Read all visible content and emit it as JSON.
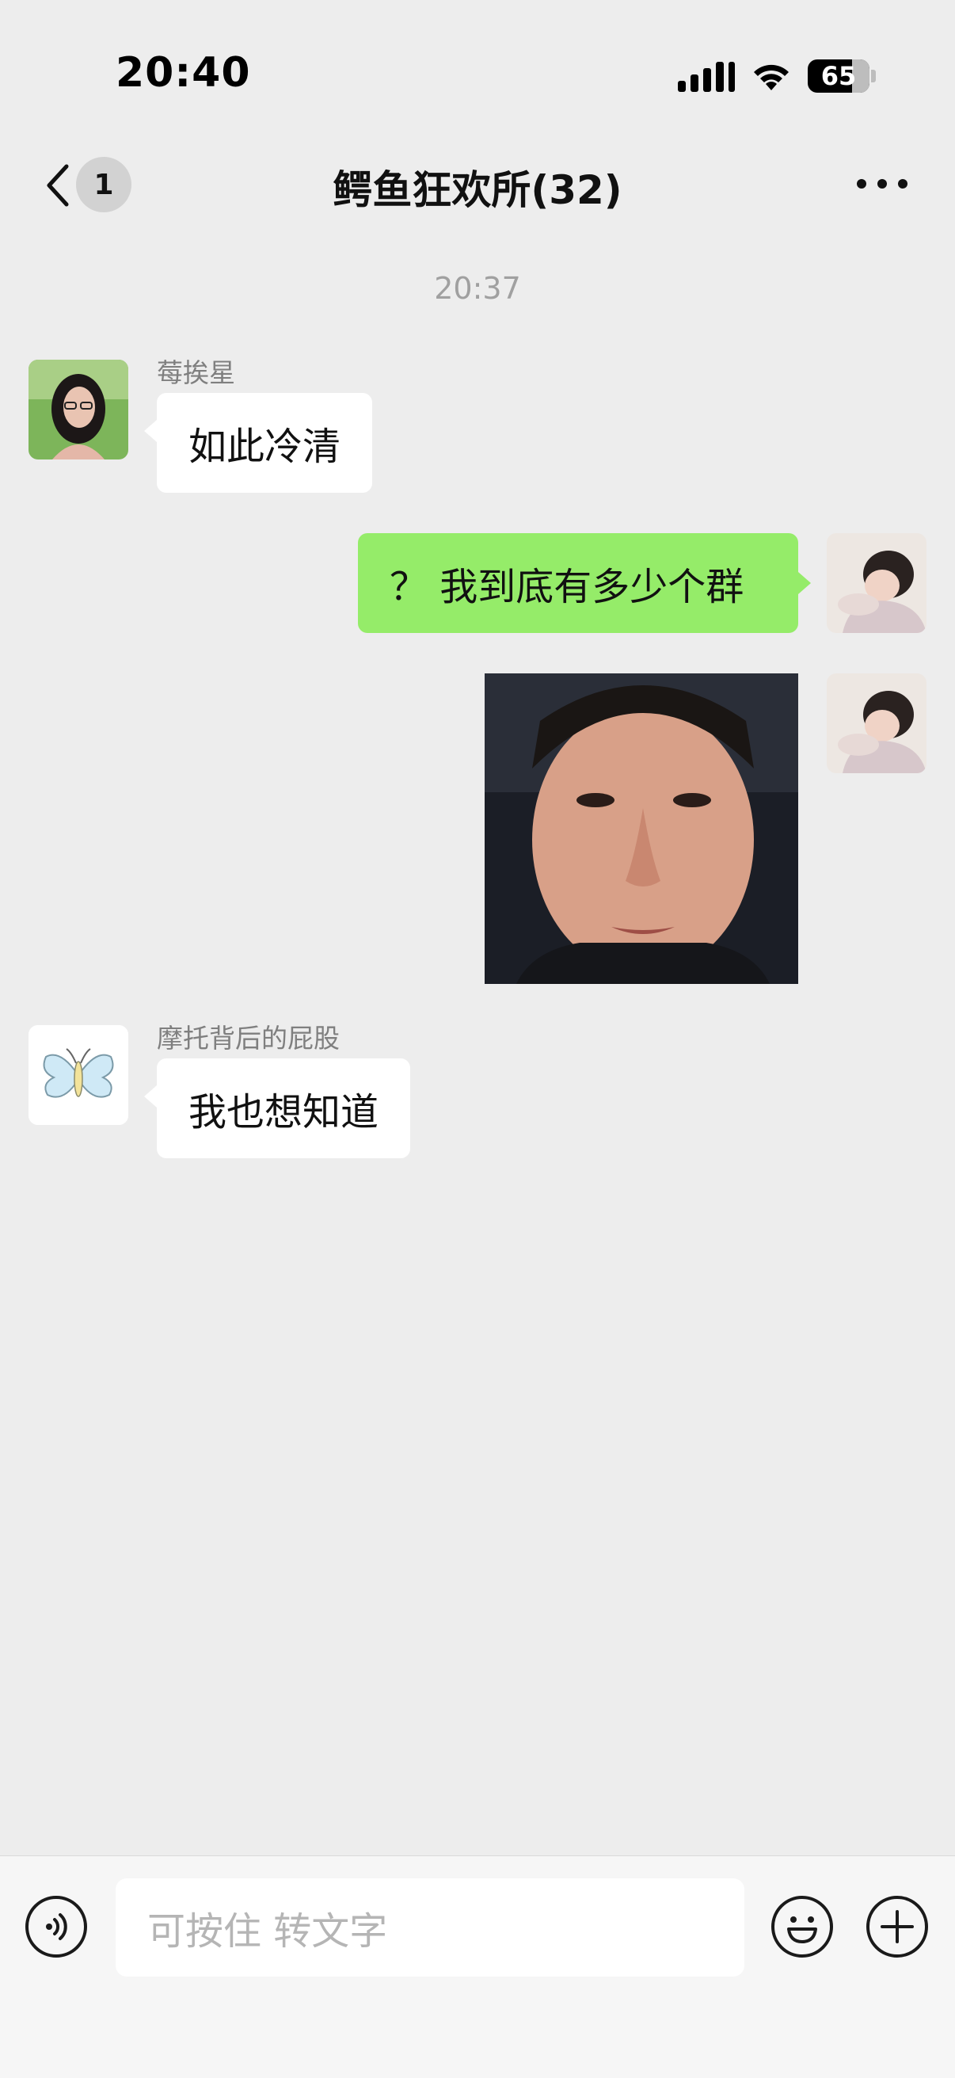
{
  "status_bar": {
    "time": "20:40",
    "battery": "65",
    "battery_level": 0.65
  },
  "nav": {
    "unread_count": "1",
    "title": "鳄鱼狂欢所(32)"
  },
  "chat": {
    "timestamp": "20:37",
    "messages": [
      {
        "sender": "莓挨星",
        "text": "如此冷清",
        "direction": "incoming"
      },
      {
        "text": "？ 我到底有多少个群",
        "direction": "outgoing"
      },
      {
        "type": "sticker",
        "direction": "outgoing"
      },
      {
        "sender": "摩托背后的屁股",
        "text": "我也想知道",
        "direction": "incoming"
      }
    ]
  },
  "input_bar": {
    "placeholder": "可按住 转文字"
  },
  "colors": {
    "background": "#EDEDED",
    "outgoing_bubble": "#95EC69",
    "incoming_bubble": "#FFFFFF"
  }
}
